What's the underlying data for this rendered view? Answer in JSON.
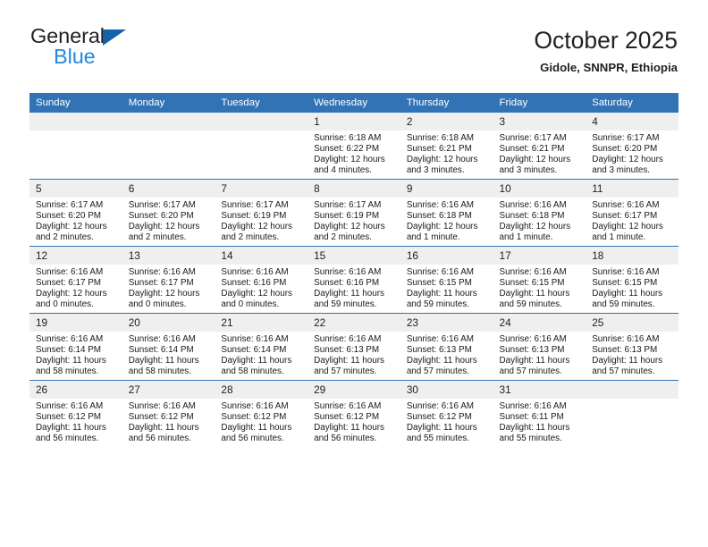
{
  "brand": {
    "name_top": "General",
    "name_bottom": "Blue",
    "triangle_color": "#1461ab",
    "bottom_color": "#2288dd"
  },
  "header": {
    "title": "October 2025",
    "subtitle": "Gidole, SNNPR, Ethiopia"
  },
  "theme": {
    "header_blue": "#3273b5",
    "daynum_band": "#efefef",
    "text": "#1a1a1a"
  },
  "calendar": {
    "weekday_headers": [
      "Sunday",
      "Monday",
      "Tuesday",
      "Wednesday",
      "Thursday",
      "Friday",
      "Saturday"
    ],
    "weeks": [
      [
        {
          "day": "",
          "lines": []
        },
        {
          "day": "",
          "lines": []
        },
        {
          "day": "",
          "lines": []
        },
        {
          "day": "1",
          "lines": [
            "Sunrise: 6:18 AM",
            "Sunset: 6:22 PM",
            "Daylight: 12 hours",
            "and 4 minutes."
          ]
        },
        {
          "day": "2",
          "lines": [
            "Sunrise: 6:18 AM",
            "Sunset: 6:21 PM",
            "Daylight: 12 hours",
            "and 3 minutes."
          ]
        },
        {
          "day": "3",
          "lines": [
            "Sunrise: 6:17 AM",
            "Sunset: 6:21 PM",
            "Daylight: 12 hours",
            "and 3 minutes."
          ]
        },
        {
          "day": "4",
          "lines": [
            "Sunrise: 6:17 AM",
            "Sunset: 6:20 PM",
            "Daylight: 12 hours",
            "and 3 minutes."
          ]
        }
      ],
      [
        {
          "day": "5",
          "lines": [
            "Sunrise: 6:17 AM",
            "Sunset: 6:20 PM",
            "Daylight: 12 hours",
            "and 2 minutes."
          ]
        },
        {
          "day": "6",
          "lines": [
            "Sunrise: 6:17 AM",
            "Sunset: 6:20 PM",
            "Daylight: 12 hours",
            "and 2 minutes."
          ]
        },
        {
          "day": "7",
          "lines": [
            "Sunrise: 6:17 AM",
            "Sunset: 6:19 PM",
            "Daylight: 12 hours",
            "and 2 minutes."
          ]
        },
        {
          "day": "8",
          "lines": [
            "Sunrise: 6:17 AM",
            "Sunset: 6:19 PM",
            "Daylight: 12 hours",
            "and 2 minutes."
          ]
        },
        {
          "day": "9",
          "lines": [
            "Sunrise: 6:16 AM",
            "Sunset: 6:18 PM",
            "Daylight: 12 hours",
            "and 1 minute."
          ]
        },
        {
          "day": "10",
          "lines": [
            "Sunrise: 6:16 AM",
            "Sunset: 6:18 PM",
            "Daylight: 12 hours",
            "and 1 minute."
          ]
        },
        {
          "day": "11",
          "lines": [
            "Sunrise: 6:16 AM",
            "Sunset: 6:17 PM",
            "Daylight: 12 hours",
            "and 1 minute."
          ]
        }
      ],
      [
        {
          "day": "12",
          "lines": [
            "Sunrise: 6:16 AM",
            "Sunset: 6:17 PM",
            "Daylight: 12 hours",
            "and 0 minutes."
          ]
        },
        {
          "day": "13",
          "lines": [
            "Sunrise: 6:16 AM",
            "Sunset: 6:17 PM",
            "Daylight: 12 hours",
            "and 0 minutes."
          ]
        },
        {
          "day": "14",
          "lines": [
            "Sunrise: 6:16 AM",
            "Sunset: 6:16 PM",
            "Daylight: 12 hours",
            "and 0 minutes."
          ]
        },
        {
          "day": "15",
          "lines": [
            "Sunrise: 6:16 AM",
            "Sunset: 6:16 PM",
            "Daylight: 11 hours",
            "and 59 minutes."
          ]
        },
        {
          "day": "16",
          "lines": [
            "Sunrise: 6:16 AM",
            "Sunset: 6:15 PM",
            "Daylight: 11 hours",
            "and 59 minutes."
          ]
        },
        {
          "day": "17",
          "lines": [
            "Sunrise: 6:16 AM",
            "Sunset: 6:15 PM",
            "Daylight: 11 hours",
            "and 59 minutes."
          ]
        },
        {
          "day": "18",
          "lines": [
            "Sunrise: 6:16 AM",
            "Sunset: 6:15 PM",
            "Daylight: 11 hours",
            "and 59 minutes."
          ]
        }
      ],
      [
        {
          "day": "19",
          "lines": [
            "Sunrise: 6:16 AM",
            "Sunset: 6:14 PM",
            "Daylight: 11 hours",
            "and 58 minutes."
          ]
        },
        {
          "day": "20",
          "lines": [
            "Sunrise: 6:16 AM",
            "Sunset: 6:14 PM",
            "Daylight: 11 hours",
            "and 58 minutes."
          ]
        },
        {
          "day": "21",
          "lines": [
            "Sunrise: 6:16 AM",
            "Sunset: 6:14 PM",
            "Daylight: 11 hours",
            "and 58 minutes."
          ]
        },
        {
          "day": "22",
          "lines": [
            "Sunrise: 6:16 AM",
            "Sunset: 6:13 PM",
            "Daylight: 11 hours",
            "and 57 minutes."
          ]
        },
        {
          "day": "23",
          "lines": [
            "Sunrise: 6:16 AM",
            "Sunset: 6:13 PM",
            "Daylight: 11 hours",
            "and 57 minutes."
          ]
        },
        {
          "day": "24",
          "lines": [
            "Sunrise: 6:16 AM",
            "Sunset: 6:13 PM",
            "Daylight: 11 hours",
            "and 57 minutes."
          ]
        },
        {
          "day": "25",
          "lines": [
            "Sunrise: 6:16 AM",
            "Sunset: 6:13 PM",
            "Daylight: 11 hours",
            "and 57 minutes."
          ]
        }
      ],
      [
        {
          "day": "26",
          "lines": [
            "Sunrise: 6:16 AM",
            "Sunset: 6:12 PM",
            "Daylight: 11 hours",
            "and 56 minutes."
          ]
        },
        {
          "day": "27",
          "lines": [
            "Sunrise: 6:16 AM",
            "Sunset: 6:12 PM",
            "Daylight: 11 hours",
            "and 56 minutes."
          ]
        },
        {
          "day": "28",
          "lines": [
            "Sunrise: 6:16 AM",
            "Sunset: 6:12 PM",
            "Daylight: 11 hours",
            "and 56 minutes."
          ]
        },
        {
          "day": "29",
          "lines": [
            "Sunrise: 6:16 AM",
            "Sunset: 6:12 PM",
            "Daylight: 11 hours",
            "and 56 minutes."
          ]
        },
        {
          "day": "30",
          "lines": [
            "Sunrise: 6:16 AM",
            "Sunset: 6:12 PM",
            "Daylight: 11 hours",
            "and 55 minutes."
          ]
        },
        {
          "day": "31",
          "lines": [
            "Sunrise: 6:16 AM",
            "Sunset: 6:11 PM",
            "Daylight: 11 hours",
            "and 55 minutes."
          ]
        },
        {
          "day": "",
          "lines": []
        }
      ]
    ]
  }
}
